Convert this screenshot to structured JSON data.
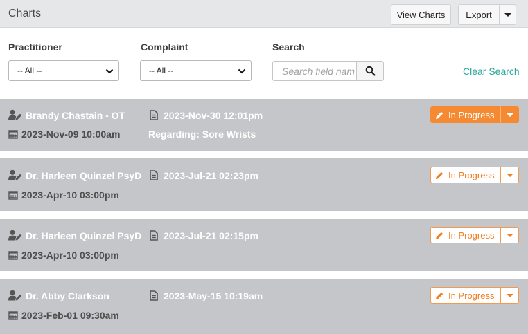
{
  "header": {
    "title": "Charts",
    "view_charts_label": "View Charts",
    "export_label": "Export"
  },
  "filters": {
    "practitioner_label": "Practitioner",
    "practitioner_value": "-- All --",
    "complaint_label": "Complaint",
    "complaint_value": "-- All --",
    "search_label": "Search",
    "search_placeholder": "Search field nam",
    "clear_label": "Clear Search"
  },
  "charts": [
    {
      "practitioner": "Brandy Chastain - OT",
      "chart_datetime": "2023-Nov-30 12:01pm",
      "appointment": "2023-Nov-09 10:00am",
      "regarding": "Regarding: Sore Wrists",
      "status": "In Progress"
    },
    {
      "practitioner": "Dr. Harleen Quinzel PsyD",
      "chart_datetime": "2023-Jul-21 02:23pm",
      "appointment": "2023-Apr-10 03:00pm",
      "regarding": "",
      "status": "In Progress"
    },
    {
      "practitioner": "Dr. Harleen Quinzel PsyD",
      "chart_datetime": "2023-Jul-21 02:15pm",
      "appointment": "2023-Apr-10 03:00pm",
      "regarding": "",
      "status": "In Progress"
    },
    {
      "practitioner": "Dr. Abby Clarkson",
      "chart_datetime": "2023-May-15 10:19am",
      "appointment": "2023-Feb-01 09:30am",
      "regarding": "",
      "status": "In Progress"
    }
  ],
  "colors": {
    "accent_orange": "#f58a33",
    "link_teal": "#2aa79b",
    "card_gray": "#c4c6c9"
  }
}
